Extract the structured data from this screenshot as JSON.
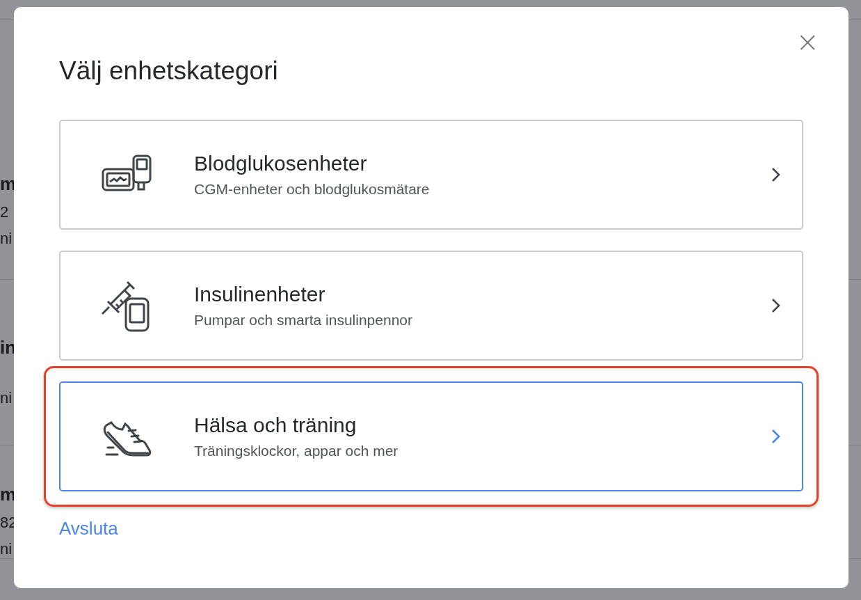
{
  "background": {
    "rows": [
      {
        "lines": [
          {
            "text": "m",
            "kind": "bold"
          },
          {
            "text": "2",
            "kind": "plain"
          },
          {
            "text": "ni",
            "kind": "plain"
          }
        ]
      },
      {
        "lines": [
          {
            "text": "in",
            "kind": "bold"
          },
          {
            "text": "ni",
            "kind": "plain"
          }
        ]
      },
      {
        "lines": [
          {
            "text": "m",
            "kind": "bold"
          },
          {
            "text": "82",
            "kind": "plain"
          },
          {
            "text": "ni",
            "kind": "plain"
          }
        ]
      }
    ]
  },
  "dialog": {
    "title": "Välj enhetskategori",
    "close": "×",
    "categories": [
      {
        "title": "Blodglukosenheter",
        "subtitle": "CGM-enheter och blodglukosmätare",
        "selected": false,
        "highlighted": false
      },
      {
        "title": "Insulinenheter",
        "subtitle": "Pumpar och smarta insulinpennor",
        "selected": false,
        "highlighted": false
      },
      {
        "title": "Hälsa och träning",
        "subtitle": "Träningsklockor, appar och mer",
        "selected": true,
        "highlighted": true
      }
    ],
    "exit_link": "Avsluta"
  }
}
